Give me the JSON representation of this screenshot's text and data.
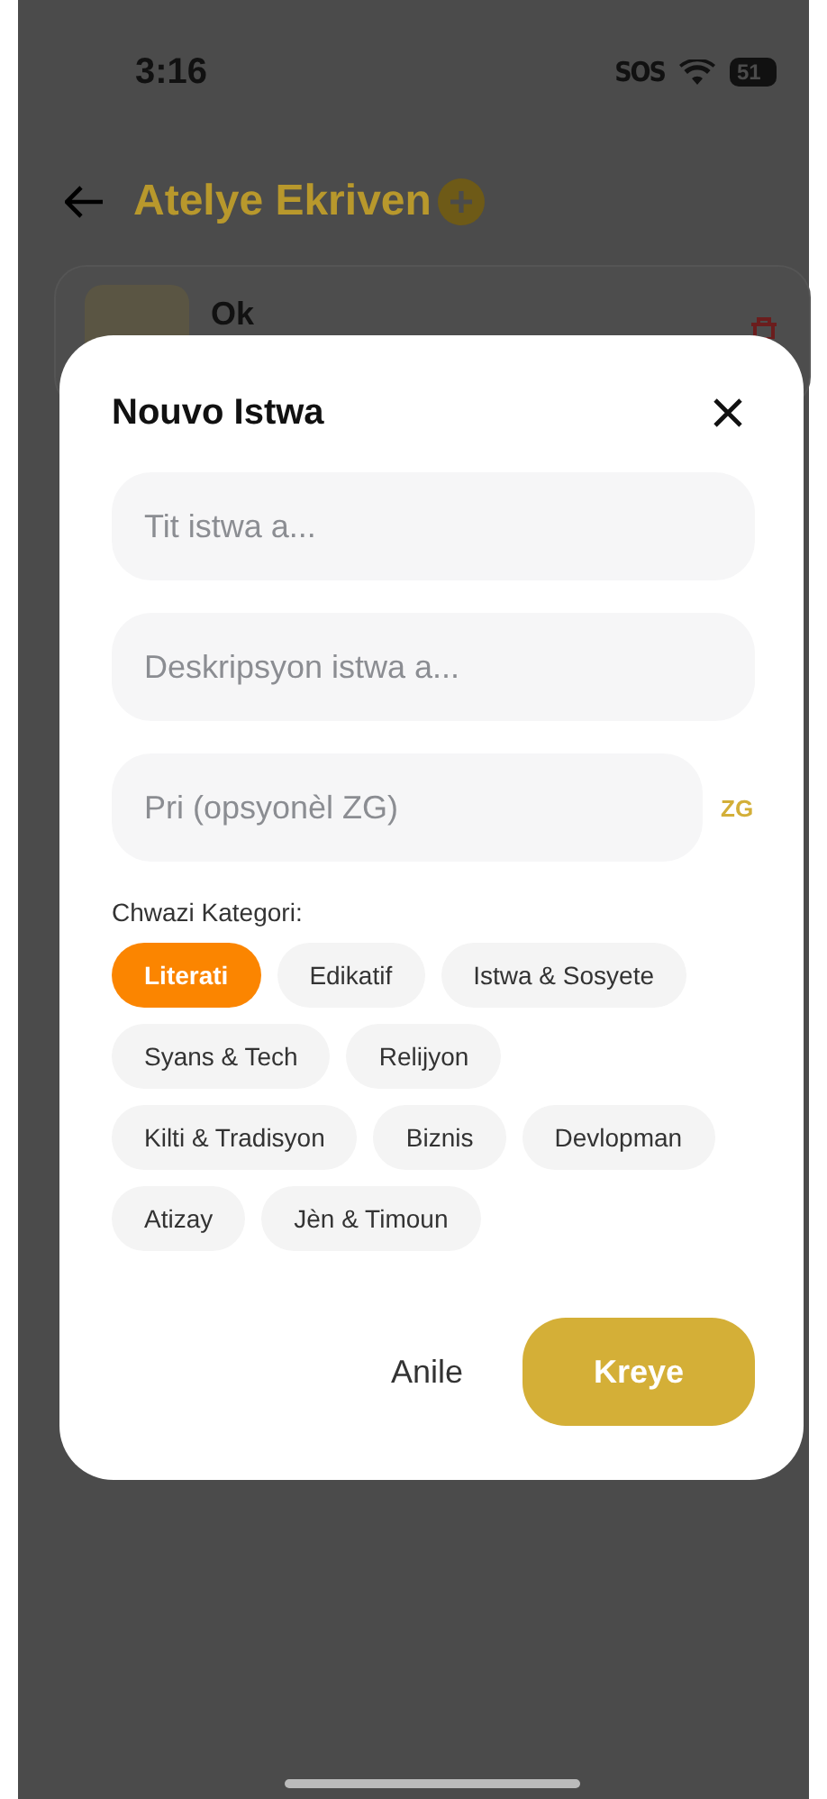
{
  "status_bar": {
    "time": "3:16",
    "carrier": "SOS",
    "battery": "51"
  },
  "header": {
    "title": "Atelye Ekriven"
  },
  "stories": [
    {
      "title": "Ok"
    }
  ],
  "dialog": {
    "title": "Nouvo Istwa",
    "fields": [
      {
        "kind": "text",
        "placeholder": "Tit istwa a..."
      },
      {
        "kind": "text",
        "placeholder": "Deskripsyon istwa a..."
      },
      {
        "kind": "price",
        "placeholder": "Pri (opsyonèl ZG)",
        "unit": "ZG"
      }
    ],
    "category_label": "Chwazi Kategori:",
    "categories": [
      {
        "label": "Literati",
        "selected": true
      },
      {
        "label": "Edikatif",
        "selected": false
      },
      {
        "label": "Istwa & Sosyete",
        "selected": false
      },
      {
        "label": "Syans & Tech",
        "selected": false
      },
      {
        "label": "Relijyon",
        "selected": false
      },
      {
        "label": "Kilti & Tradisyon",
        "selected": false
      },
      {
        "label": "Biznis",
        "selected": false
      },
      {
        "label": "Devlopman",
        "selected": false
      },
      {
        "label": "Atizay",
        "selected": false
      },
      {
        "label": "Jèn & Timoun",
        "selected": false
      }
    ],
    "cancel": "Anile",
    "confirm": "Kreye"
  }
}
